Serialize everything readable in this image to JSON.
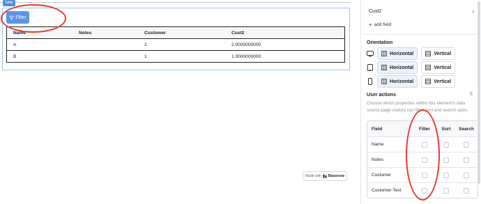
{
  "canvas": {
    "table_tag": "Table",
    "filter_button": {
      "label": "Filter",
      "icon": "filter-icon"
    },
    "table": {
      "headers": [
        "Name",
        "Notes",
        "Customer",
        "Cust2"
      ],
      "rows": [
        [
          "A",
          "",
          "2",
          "2.0000000000"
        ],
        [
          "B",
          "",
          "1",
          "1.0000000000"
        ]
      ]
    },
    "made_with": {
      "prefix": "Made with",
      "brand": "Baserow"
    },
    "annotation_color": "#e8372f"
  },
  "side": {
    "field": {
      "name": "Cust2",
      "chevron": "chevron-right-icon"
    },
    "add_field": "add field",
    "orientation": {
      "title": "Orientation",
      "rows": [
        {
          "device": "desktop-icon",
          "horizontal": "Horizontal",
          "vertical": "Vertical"
        },
        {
          "device": "tablet-icon",
          "horizontal": "Horizontal",
          "vertical": "Vertical"
        },
        {
          "device": "phone-icon",
          "horizontal": "Horizontal",
          "vertical": "Vertical"
        }
      ]
    },
    "user_actions": {
      "title": "User actions",
      "description": "Choose which properties within this element's data source page visitors can filter, sort and search upon.",
      "headers": [
        "Field",
        "Filter",
        "Sort",
        "Search"
      ],
      "rows": [
        {
          "label": "Name"
        },
        {
          "label": "Notes"
        },
        {
          "label": "Customer"
        },
        {
          "label": "Customer-Text"
        }
      ]
    }
  },
  "colors": {
    "accent": "#5b93e9",
    "selected_bg": "#ecf2fb"
  }
}
